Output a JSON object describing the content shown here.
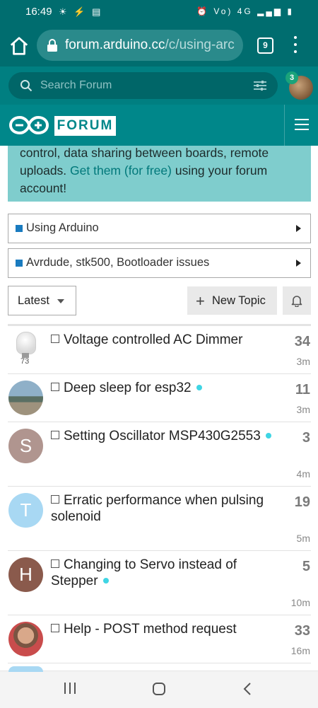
{
  "status_bar": {
    "time": "16:49",
    "right_text": "Vo) 4G"
  },
  "browser": {
    "url_host": "forum.arduino.cc",
    "url_rest": "/c/using-arc",
    "tab_count": "9"
  },
  "forum": {
    "search_placeholder": "Search Forum",
    "notification_count": "3",
    "forum_label": "FORUM",
    "banner": {
      "text1": "control, data sharing between boards, remote uploads. ",
      "link": "Get them (for free)",
      "text2": " using your forum account!"
    },
    "category": "Using Arduino",
    "subcategory": "Avrdude, stk500, Bootloader issues",
    "sort_label": "Latest",
    "new_topic_label": "New Topic"
  },
  "topics": [
    {
      "title": "Voltage controlled AC Dimmer",
      "replies": "34",
      "age": "3m",
      "avatar_letter": "",
      "avatar_caption": "73",
      "new": false
    },
    {
      "title": "Deep sleep for esp32",
      "replies": "11",
      "age": "3m",
      "avatar_letter": "",
      "new": true
    },
    {
      "title": "Setting Oscillator MSP430G2553",
      "replies": "3",
      "age": "4m",
      "avatar_letter": "S",
      "new": true
    },
    {
      "title": "Erratic performance when pulsing solenoid",
      "replies": "19",
      "age": "5m",
      "avatar_letter": "T",
      "new": false
    },
    {
      "title": "Changing to Servo instead of Stepper",
      "replies": "5",
      "age": "10m",
      "avatar_letter": "H",
      "new": true
    },
    {
      "title": "Help - POST method request",
      "replies": "33",
      "age": "16m",
      "avatar_letter": "",
      "new": false
    }
  ],
  "colors": {
    "accent": "#00878a",
    "status": "#006d6f",
    "unread_dot": "#3fd5e4"
  }
}
